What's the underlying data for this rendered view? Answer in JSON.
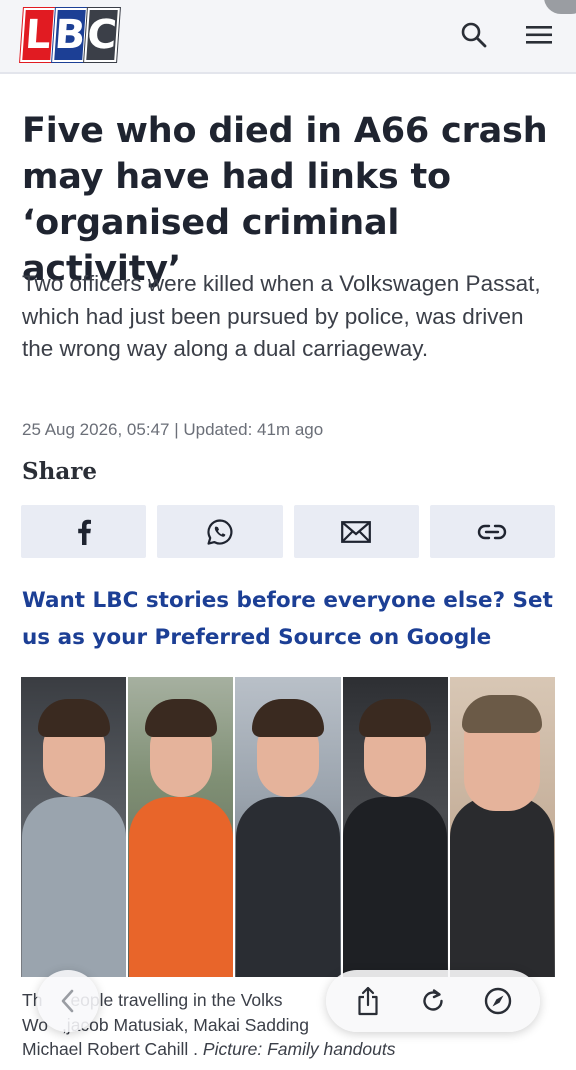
{
  "header": {
    "logo_letters": [
      "L",
      "B",
      "C"
    ],
    "search_icon": "search-icon",
    "menu_icon": "hamburger-menu-icon",
    "brand_colors": {
      "red": "#e11b22",
      "blue": "#1c3f95",
      "grey": "#3b3f48"
    }
  },
  "article": {
    "headline": "Five who died in A66 crash may have had links to ‘organised criminal activity’",
    "standfirst": "Two officers were killed when a Volkswagen Passat, which had just been pursued by police, was driven the wrong way along a dual carriageway.",
    "meta": "25 Aug 2026, 05:47 | Updated: 41m ago",
    "share_label": "Share",
    "share_buttons": [
      {
        "icon": "facebook-icon"
      },
      {
        "icon": "whatsapp-icon"
      },
      {
        "icon": "email-icon"
      },
      {
        "icon": "link-icon"
      }
    ],
    "promo": "Want LBC stories before everyone else? Set us as your Preferred Source on Google",
    "caption_visible": "Th        eople travelling in the Volks",
    "caption_line2": "Wo    ,jacob Matusiak, Makai Sadding",
    "caption_line3_prefix": "Michael Robert Cahill . ",
    "caption_credit": "Picture: Family handouts"
  },
  "browser": {
    "back_icon": "chevron-left-icon",
    "share_icon": "share-icon",
    "reload_icon": "reload-icon",
    "compass_icon": "compass-icon"
  }
}
